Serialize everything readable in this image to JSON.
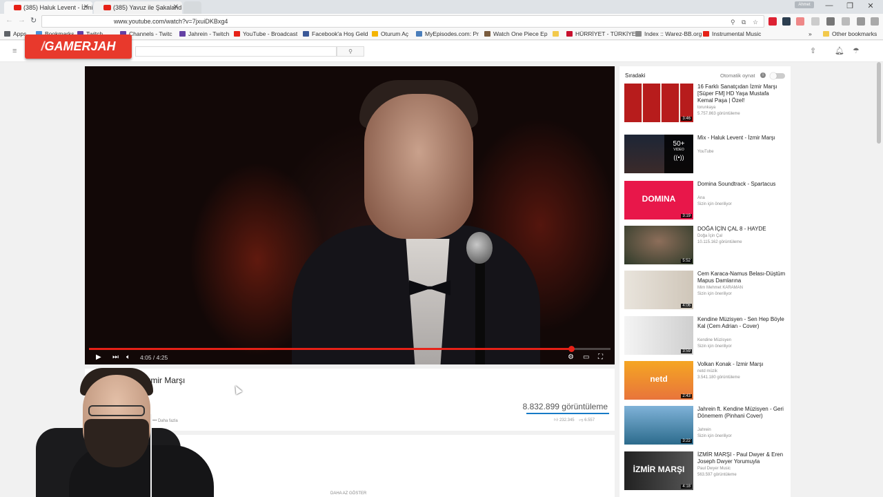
{
  "browser": {
    "tabs": [
      {
        "title": "(385) Haluk Levent - İzmi",
        "active": true
      },
      {
        "title": "(385) Yavuz ile Şakalandı",
        "active": false
      }
    ],
    "profile": "Ahmet",
    "url": "www.youtube.com/watch?v=7jxuiDKBxg4",
    "bookmarks": [
      {
        "label": "Apps",
        "fav": "#5f6368"
      },
      {
        "label": "Bookmarks",
        "fav": "#4a90d9"
      },
      {
        "label": "Twitch",
        "fav": "#6441a4"
      },
      {
        "label": "Channels - Twitc",
        "fav": "#6441a4"
      },
      {
        "label": "Jahrein - Twitch",
        "fav": "#6441a4"
      },
      {
        "label": "YouTube - Broadcast",
        "fav": "#e62117"
      },
      {
        "label": "Facebook'a Hoş Geld",
        "fav": "#3b5998"
      },
      {
        "label": "Oturum Aç",
        "fav": "#f4b400"
      },
      {
        "label": "MyEpisodes.com: Pr",
        "fav": "#4a7ebb"
      },
      {
        "label": "Watch One Piece Ep",
        "fav": "#7a5c3e"
      },
      {
        "label": "HÜRRİYET - TÜRKİYE",
        "fav": "#c8102e"
      },
      {
        "label": "Index :: Warez-BB.org",
        "fav": "#888888"
      },
      {
        "label": "Instrumental Music",
        "fav": "#e62117"
      }
    ],
    "other_bookmarks": "Other bookmarks"
  },
  "watermark": "GAMERJAH",
  "player": {
    "time": "4:05 / 4:25",
    "progress": 0.925
  },
  "video": {
    "title": "İzmir Marşı",
    "views": "8.832.899 görüntüleme",
    "likes": "232.345",
    "dislikes": "6.557",
    "more": "Daha fazla",
    "show_less": "DAHA AZ GÖSTER"
  },
  "sidebar": {
    "up_next": "Sıradaki",
    "autoplay": "Otomatik oynat",
    "items": [
      {
        "title": "16 Farklı Sanatçıdan İzmir Marşı [Süper FM] HD Yaşa Mustafa Kemal Paşa | Özel!",
        "meta1": "torunkaya",
        "meta2": "5.757.863 görüntüleme",
        "duration": "3:46",
        "thumb": "a"
      },
      {
        "title": "Mix - Haluk Levent - İzmir Marşı",
        "meta1": "YouTube",
        "meta2": "",
        "duration": "",
        "thumb": "b",
        "mix_count": "50+",
        "mix_sub": "VIDEO"
      },
      {
        "title": "Domina Soundtrack - Spartacus",
        "meta1": "Ana",
        "meta2": "Sizin için öneriliyor",
        "duration": "3:19",
        "thumb": "c",
        "thumb_text": "DOMINA"
      },
      {
        "title": "DOĞA İÇİN ÇAL 8 - HAYDE",
        "meta1": "Doğa İçin Çal",
        "meta2": "10.115.162 görüntüleme",
        "duration": "5:52",
        "thumb": "d"
      },
      {
        "title": "Cem Karaca-Namus Belası-Düştüm Mapus Damlarına",
        "meta1": "Mim Mehmet KARAMAN",
        "meta2": "Sizin için öneriliyor",
        "duration": "4:06",
        "thumb": "e"
      },
      {
        "title": "Kendine Müzisyen - Sen Hep Böyle Kal (Cem Adrian - Cover)",
        "meta1": "Kendine Müzisyen",
        "meta2": "Sizin için öneriliyor",
        "duration": "3:59",
        "thumb": "f"
      },
      {
        "title": "Volkan Konak - İzmir Marşı",
        "meta1": "netd müzik",
        "meta2": "3.541.180 görüntüleme",
        "duration": "2:43",
        "thumb": "g",
        "thumb_text": "netd"
      },
      {
        "title": "Jahrein ft. Kendine Müzisyen - Geri Dönemem (Pinhani Cover)",
        "meta1": "Jahrein",
        "meta2": "Sizin için öneriliyor",
        "duration": "3:22",
        "thumb": "h"
      },
      {
        "title": "İZMİR MARŞI - Paul Dwyer & Eren Joseph Dwyer Yorumuyla",
        "meta1": "Paul Dwyer Music",
        "meta2": "563.597 görüntüleme",
        "duration": "4:18",
        "thumb": "i",
        "thumb_text": "İZMİR MARŞI"
      }
    ]
  }
}
